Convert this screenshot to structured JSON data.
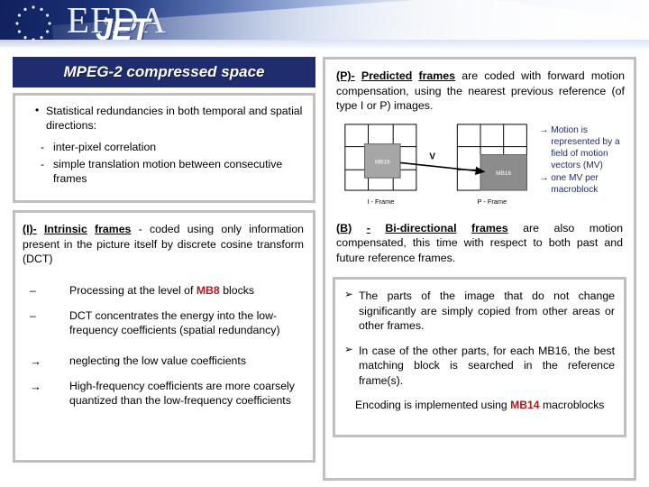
{
  "header": {
    "logo_efda": "EFDA",
    "logo_jet": "JET",
    "eu_stars_count": 12
  },
  "title": {
    "text": "MPEG-2 compressed space"
  },
  "left": {
    "box1": {
      "bullets": [
        "Statistical redundancies in both temporal and spatial directions:"
      ],
      "sub_bullets": [
        "inter-pixel correlation",
        "simple translation motion between consecutive frames"
      ]
    },
    "box2": {
      "intro_label_1": "(I)-",
      "intro_label_2": "Intrinsic",
      "intro_label_3": "frames",
      "intro_rest": " - coded using only information present in the picture itself by discrete cosine transform (DCT)",
      "dash_items": [
        {
          "pre": "Processing at the level of ",
          "highlight": "MB8",
          "post": " blocks"
        },
        {
          "pre": "DCT concentrates the energy into the low-frequency coefficients (spatial redundancy)",
          "highlight": "",
          "post": ""
        }
      ],
      "arrow_items": [
        "neglecting the low value coefficients",
        "High-frequency coefficients are more coarsely quantized than the low-frequency coefficients"
      ]
    }
  },
  "right": {
    "p_frame": {
      "label_1": "(P)-",
      "label_2": "Predicted",
      "label_3": "frames",
      "rest": " are coded with forward motion compensation, using the nearest previous reference (of type I or P) images."
    },
    "diagram": {
      "left_frame_caption": "I - Frame",
      "right_frame_caption": "P - Frame",
      "left_block_label": "MB16",
      "right_block_label": "MB16",
      "vector_label": "V"
    },
    "mv_notes": [
      "Motion is represented by a field of motion vectors (MV)",
      "one MV per macroblock"
    ],
    "b_frame": {
      "label_1": "(B)",
      "label_2": "-",
      "label_3": "Bi-directional",
      "label_4": "frames",
      "rest": " are also motion compensated, this time with respect to both past and future reference frames."
    },
    "bottom_box": {
      "chevron_items": [
        "The parts of the image that do not change significantly are simply copied from other areas or other frames.",
        "In case of the other parts, for each MB16, the best matching block is searched in the reference frame(s)."
      ],
      "encoding_pre": "Encoding   is   implemented   using   ",
      "encoding_highlight": "MB14",
      "encoding_post": " macroblocks"
    }
  },
  "colors": {
    "title_bar": "#1f2d6e",
    "box_border": "#bfbfbf",
    "highlight_red": "#aa1c22",
    "note_navy": "#1f2d6e"
  }
}
